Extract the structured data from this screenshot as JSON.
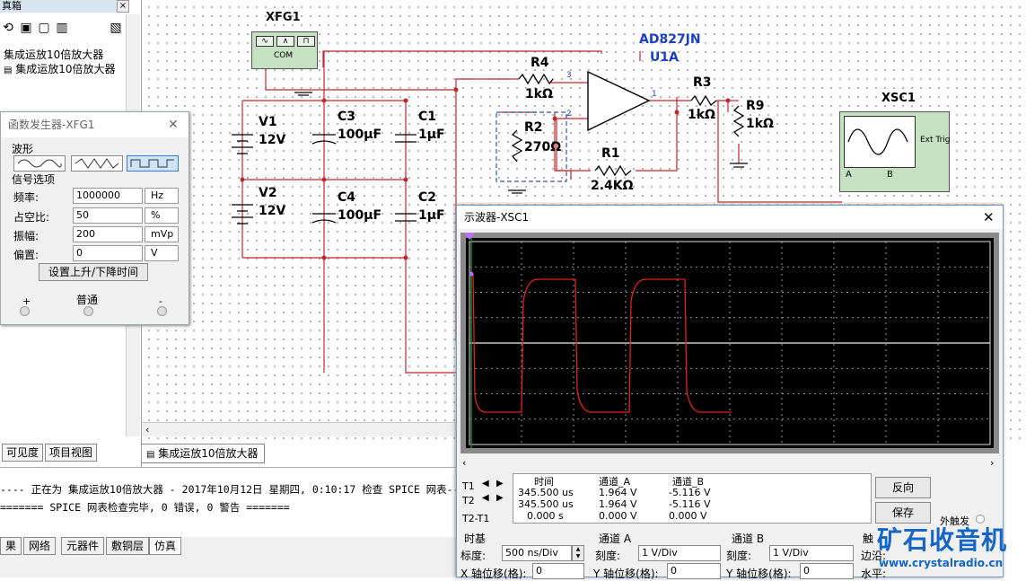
{
  "left_panel": {
    "title": "真箱",
    "tree": [
      "集成运放10倍放大器",
      "集成运放10倍放大器"
    ],
    "tabs": [
      "可见度",
      "项目视图"
    ]
  },
  "design_tab": "集成运放10倍放大器",
  "log": {
    "line1": "---- 正在为 集成运放10倍放大器 - 2017年10月12日 星期四, 0:10:17 检查 SPICE 网表-----",
    "line2": "======= SPICE 网表检查完毕, 0 错误, 0 警告 ======="
  },
  "bottom_tabs": [
    "果",
    "网络",
    "元器件",
    "敷铜层",
    "仿真"
  ],
  "schematic": {
    "xfg1": "XFG1",
    "xfg_com": "COM",
    "v1": "V1",
    "v1_val": "12V",
    "v2": "V2",
    "v2_val": "12V",
    "c3": "C3",
    "c3_val": "100µF",
    "c4": "C4",
    "c4_val": "100µF",
    "c1": "C1",
    "c1_val": "1µF",
    "c2": "C2",
    "c2_val": "1µF",
    "r4": "R4",
    "r4_val": "1kΩ",
    "r2": "R2",
    "r2_val": "270Ω",
    "r1": "R1",
    "r1_val": "2.4KΩ",
    "r3": "R3",
    "r3_val": "1kΩ",
    "r9": "R9",
    "r9_val": "1kΩ",
    "opamp": "AD827JN",
    "opamp_ref": "U1A",
    "pin3": "3",
    "pin2": "2",
    "pin1": "1",
    "xsc1": "XSC1",
    "ext_trig": "Ext Trig",
    "ch_a": "A",
    "ch_b": "B"
  },
  "function_generator": {
    "title": "函数发生器-XFG1",
    "waveform_label": "波形",
    "signal_label": "信号选项",
    "rows": [
      {
        "label": "频率:",
        "value": "1000000",
        "unit": "Hz"
      },
      {
        "label": "占空比:",
        "value": "50",
        "unit": "%"
      },
      {
        "label": "振幅:",
        "value": "200",
        "unit": "mVp"
      },
      {
        "label": "偏置:",
        "value": "0",
        "unit": "V"
      }
    ],
    "rise_fall_button": "设置上升/下降时间",
    "plus": "+",
    "common": "普通",
    "minus": "-"
  },
  "oscilloscope": {
    "title": "示波器-XSC1",
    "headers": {
      "time": "时间",
      "chan_a": "通道_A",
      "chan_b": "通道_B"
    },
    "t1": {
      "label": "T1",
      "time": "345.500 us",
      "a": "1.964 V",
      "b": "-5.116 V"
    },
    "t2": {
      "label": "T2",
      "time": "345.500 us",
      "a": "1.964 V",
      "b": "-5.116 V"
    },
    "t2t1": {
      "label": "T2-T1",
      "time": "0.000 s",
      "a": "0.000 V",
      "b": "0.000 V"
    },
    "reverse_button": "反向",
    "save_button": "保存",
    "ext_trigger": "外触发",
    "timebase": {
      "label": "时基",
      "scale_label": "标度:",
      "scale_value": "500 ns/Div",
      "xpos_label": "X 轴位移(格):",
      "xpos_value": "0"
    },
    "channel_a": {
      "label": "通道 A",
      "scale_label": "刻度:",
      "scale_value": "1 V/Div",
      "ypos_label": "Y 轴位移(格):",
      "ypos_value": "0"
    },
    "channel_b": {
      "label": "通道 B",
      "scale_label": "刻度:",
      "scale_value": "1 V/Div",
      "ypos_label": "Y 轴位移(格):",
      "ypos_value": "0"
    },
    "trigger_label": "触",
    "edge_label": "边沿:",
    "level_label": "水平:"
  },
  "watermark": {
    "title": "矿石收音机",
    "url": "www.crystalradio.cn"
  }
}
